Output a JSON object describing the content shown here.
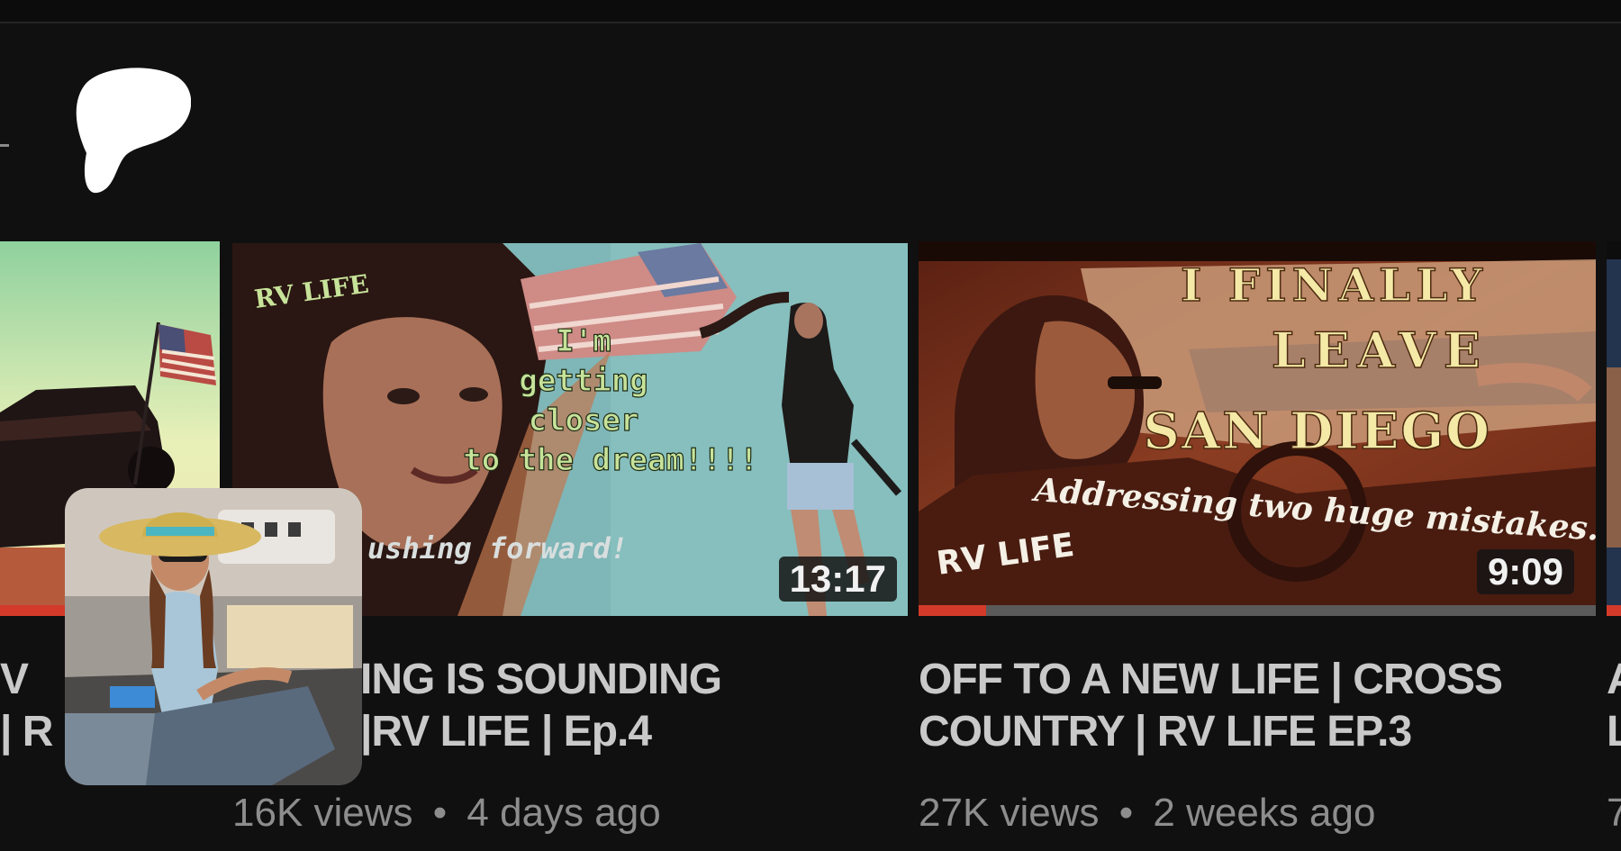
{
  "videos": [
    {
      "title_line1": "V",
      "title_line2": "| R",
      "progress_percent": 100
    },
    {
      "title_line1": "ING IS SOUNDING",
      "title_line2": "|RV LIFE | Ep.4",
      "views": "16K views",
      "age": "4 days ago",
      "separator": "•",
      "duration": "13:17",
      "thumb_badge": "RV LIFE",
      "thumb_lines": [
        "I'm",
        "getting",
        "closer",
        "to the dream!!!!"
      ],
      "thumb_caption": "ushing forward!"
    },
    {
      "title_line1": "OFF TO A NEW LIFE | CROSS",
      "title_line2": "COUNTRY | RV LIFE EP.3",
      "views": "27K views",
      "age": "2 weeks ago",
      "separator": "•",
      "duration": "9:09",
      "thumb_lines": [
        "I FINALLY",
        "LEAVE",
        "SAN DIEGO"
      ],
      "thumb_subtitle": "Addressing two huge mistakes...",
      "thumb_badge": "RV LIFE",
      "progress_percent": 10
    },
    {
      "title_line1": "A",
      "title_line2": "L",
      "meta_partial": "7"
    }
  ],
  "icons": {
    "logo": "patreon-logo-icon",
    "avatar": "channel-avatar-photo"
  },
  "colors": {
    "background": "#101010",
    "progress_fill": "#d33a2a",
    "progress_track": "#5a5a5a",
    "thumb_text_yellow": "#f4e9a6",
    "thumb_text_green": "#c7e39a"
  }
}
